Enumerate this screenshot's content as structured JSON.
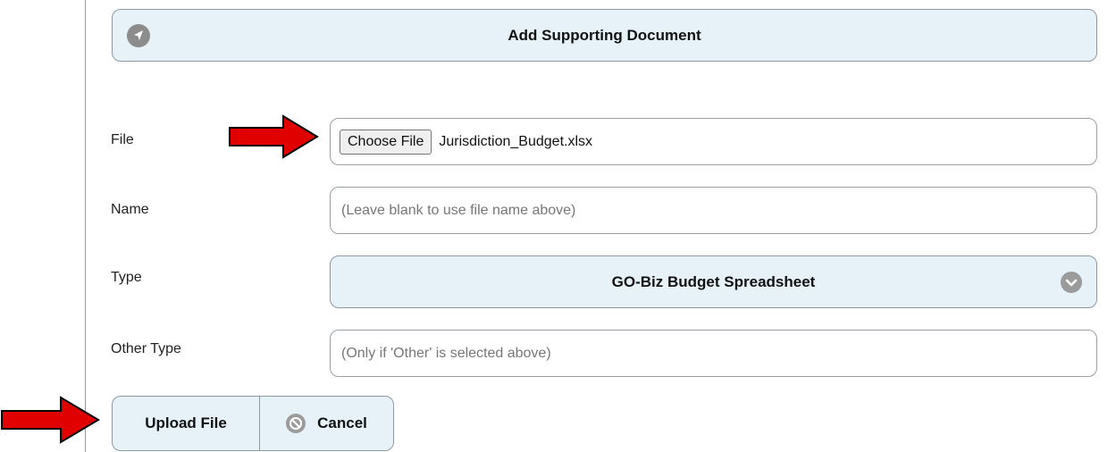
{
  "header": {
    "title": "Add Supporting Document",
    "icon": "navigation-arrow-icon"
  },
  "form": {
    "file": {
      "label": "File",
      "button_label": "Choose File",
      "file_name": "Jurisdiction_Budget.xlsx"
    },
    "name": {
      "label": "Name",
      "value": "",
      "placeholder": "(Leave blank to use file name above)"
    },
    "type": {
      "label": "Type",
      "selected": "GO-Biz Budget Spreadsheet",
      "icon": "chevron-down-icon"
    },
    "other_type": {
      "label": "Other Type",
      "value": "",
      "placeholder": "(Only if 'Other' is selected above)"
    }
  },
  "actions": {
    "upload_label": "Upload File",
    "cancel_label": "Cancel",
    "cancel_icon": "cancel-icon"
  },
  "annotations": {
    "arrow_color": "#e00000",
    "arrow_icon": "red-arrow-icon"
  },
  "colors": {
    "button_bg": "#e6f2f7",
    "border": "#8e9aa3"
  }
}
